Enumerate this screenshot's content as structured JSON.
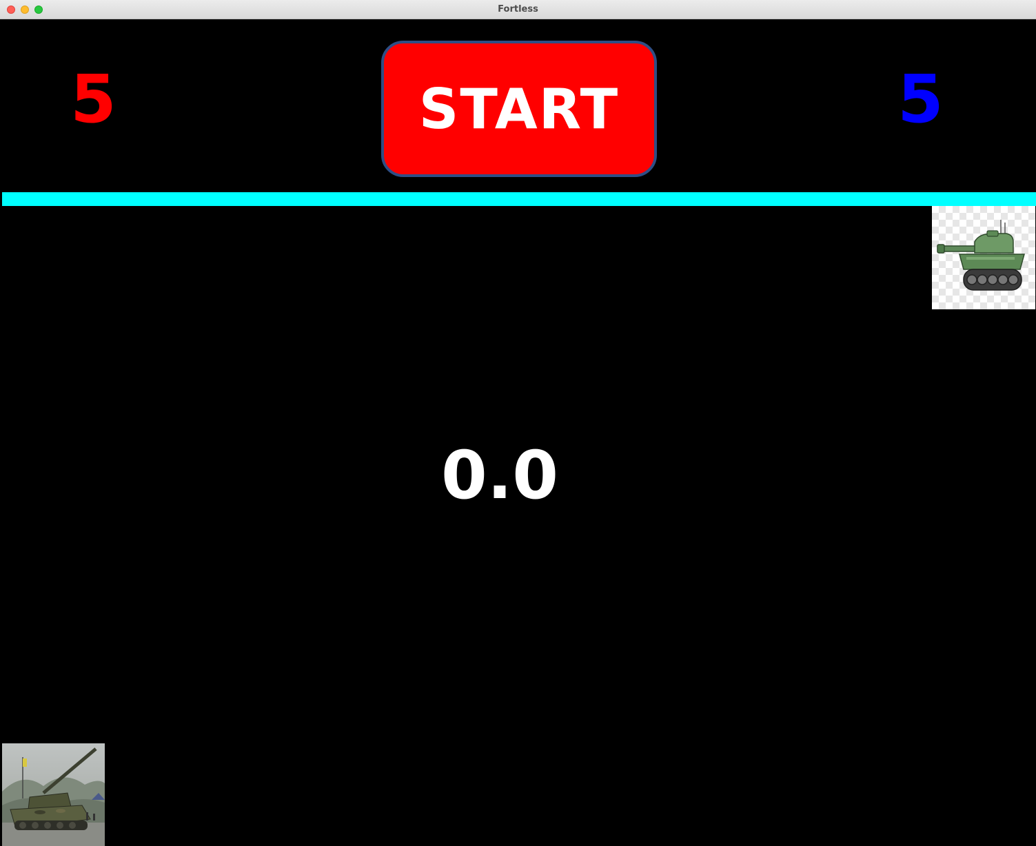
{
  "window": {
    "title": "Fortless"
  },
  "scores": {
    "red": "5",
    "blue": "5"
  },
  "start_button": {
    "label": "START"
  },
  "timer": {
    "value": "0.0"
  },
  "colors": {
    "background": "#000000",
    "red_score": "#ff0000",
    "blue_score": "#0000ff",
    "start_fill": "#ff0000",
    "start_border": "#2f4e85",
    "divider": "#00ffff",
    "timer_text": "#ffffff"
  },
  "sprites": {
    "enemy": "green-tank-cartoon-image",
    "player": "military-tank-photo-image"
  }
}
